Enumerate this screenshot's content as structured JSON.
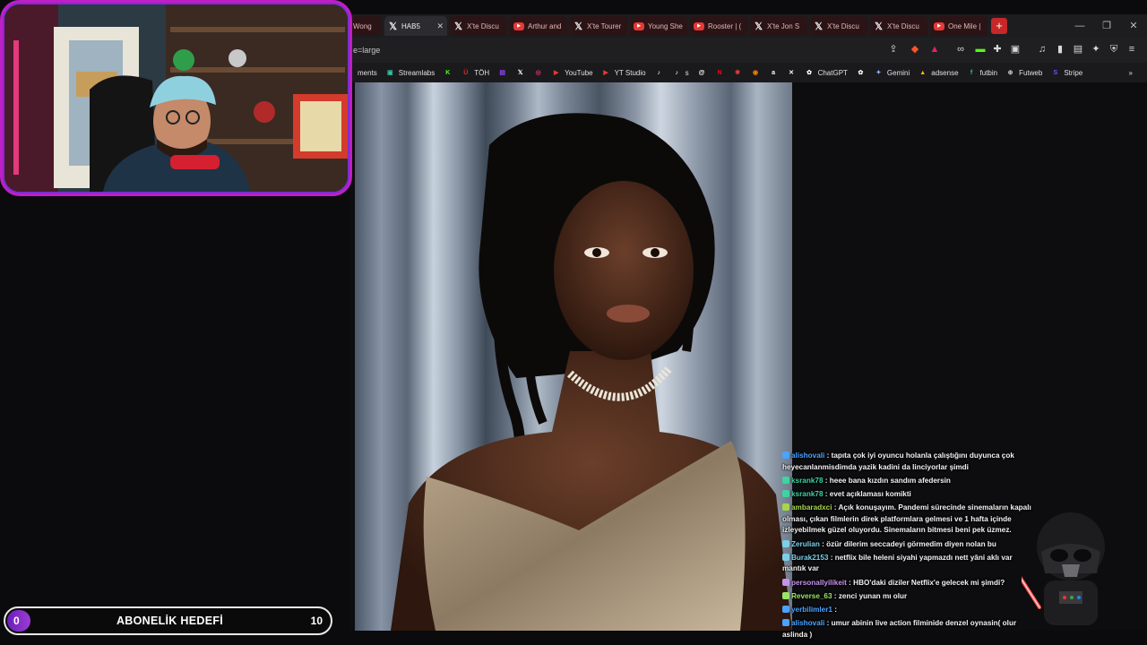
{
  "browser": {
    "tabs": [
      {
        "label": "Wong",
        "icon": "none",
        "active": false
      },
      {
        "label": "HAB5",
        "icon": "x-logo-icon",
        "active": true
      },
      {
        "label": "X'te Discu",
        "icon": "x-logo-icon",
        "active": false
      },
      {
        "label": "Arthur and",
        "icon": "youtube-icon",
        "active": false
      },
      {
        "label": "X'te Tourer",
        "icon": "x-logo-icon",
        "active": false
      },
      {
        "label": "Young She",
        "icon": "youtube-icon",
        "active": false
      },
      {
        "label": "Rooster | (",
        "icon": "youtube-icon",
        "active": false
      },
      {
        "label": "X'te Jon S",
        "icon": "x-logo-icon",
        "active": false
      },
      {
        "label": "X'te Discu",
        "icon": "x-logo-icon",
        "active": false
      },
      {
        "label": "X'te Discu",
        "icon": "x-logo-icon",
        "active": false
      },
      {
        "label": "One Mile |",
        "icon": "youtube-icon",
        "active": false
      }
    ],
    "new_tab_label": "+",
    "url": "e=large",
    "bookmarks": [
      {
        "label": "ments",
        "icon": "none",
        "color": ""
      },
      {
        "label": "Streamlabs",
        "icon": "streamlabs-icon",
        "color": "#31c3a2"
      },
      {
        "label": "",
        "icon": "kick-icon",
        "color": "#53fc18"
      },
      {
        "label": "TÖH",
        "icon": "toh-icon",
        "color": "#d32f2f"
      },
      {
        "label": "",
        "icon": "twitch-icon",
        "color": "#9146ff"
      },
      {
        "label": "",
        "icon": "x-logo-icon",
        "color": "#ffffff"
      },
      {
        "label": "",
        "icon": "instagram-icon",
        "color": "#e1306c"
      },
      {
        "label": "YouTube",
        "icon": "youtube-icon",
        "color": "#e53935"
      },
      {
        "label": "YT Studio",
        "icon": "youtube-icon",
        "color": "#e53935"
      },
      {
        "label": "",
        "icon": "tiktok-icon",
        "color": "#ffffff"
      },
      {
        "label": "s",
        "icon": "tiktok-icon",
        "color": "#ffffff"
      },
      {
        "label": "",
        "icon": "threads-icon",
        "color": "#ffffff"
      },
      {
        "label": "",
        "icon": "netflix-icon",
        "color": "#e50914"
      },
      {
        "label": "",
        "icon": "pin-icon",
        "color": "#e53935"
      },
      {
        "label": "",
        "icon": "rss-icon",
        "color": "#f57c00"
      },
      {
        "label": "",
        "icon": "amazon-icon",
        "color": "#ffffff"
      },
      {
        "label": "",
        "icon": "shuffle-icon",
        "color": "#ffffff"
      },
      {
        "label": "ChatGPT",
        "icon": "chatgpt-icon",
        "color": "#ffffff"
      },
      {
        "label": "",
        "icon": "openai-icon",
        "color": "#ffffff"
      },
      {
        "label": "Gemini",
        "icon": "gemini-icon",
        "color": "#8ab4f8"
      },
      {
        "label": "adsense",
        "icon": "adsense-icon",
        "color": "#fbbc04"
      },
      {
        "label": "futbin",
        "icon": "futbin-icon",
        "color": "#26c281"
      },
      {
        "label": "Futweb",
        "icon": "futweb-icon",
        "color": "#cccccc"
      },
      {
        "label": "Stripe",
        "icon": "stripe-icon",
        "color": "#635bff"
      }
    ],
    "bookmarks_overflow": "»"
  },
  "chat": {
    "messages": [
      {
        "user": "alishovali",
        "text": "tapıta çok iyi oyuncu holanla çalıştığını duyunca çok heyecanlanmisdimda yazik kadini da linciyorlar şimdi",
        "color": "#4aa3ff"
      },
      {
        "user": "ksrank78",
        "text": "heee bana kızdın sandım afedersin",
        "color": "#3fd3a0"
      },
      {
        "user": "ksrank78",
        "text": "evet açıklaması komikti",
        "color": "#3fd3a0"
      },
      {
        "user": "ambaradxci",
        "text": "Açık konuşayım. Pandemi sürecinde sinemaların kapalı olması, çıkan filmlerin direk platformlara gelmesi ve 1 hafta içinde izleyebilmek güzel oluyordu. Sinemaların bitmesi beni pek üzmez.",
        "color": "#a7d64a"
      },
      {
        "user": "Zerulian",
        "text": "özür dilerim seccadeyi görmedim diyen nolan bu",
        "color": "#7ad0e8"
      },
      {
        "user": "Burak2153",
        "text": "netflix bile heleni siyahi yapmazdı nett yâni aklı var mantık var",
        "color": "#7ad0e8"
      },
      {
        "user": "personallyilikeit",
        "text": "HBO'daki diziler Netflix'e gelecek mi şimdi?",
        "color": "#c792ea"
      },
      {
        "user": "Reverse_63",
        "text": "zenci yunan mı olur",
        "color": "#9be564"
      },
      {
        "user": "yerbilimler1",
        "text": "",
        "color": "#4aa3ff"
      },
      {
        "user": "alishovali",
        "text": "umur abinin live action filminide denzel oynasin( olur aslinda )",
        "color": "#4aa3ff"
      }
    ]
  },
  "goal": {
    "title": "ABONELİK HEDEFİ",
    "current": "0",
    "target": "10",
    "progress_fraction": 0
  }
}
